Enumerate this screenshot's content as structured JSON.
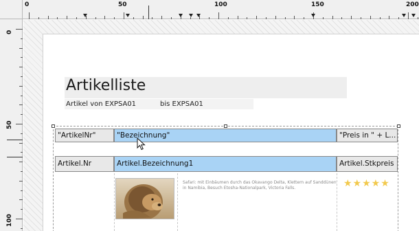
{
  "rulers": {
    "horizontal_labels": [
      "0",
      "50",
      "100",
      "150",
      "200"
    ],
    "vertical_labels": [
      "0",
      "50",
      "100"
    ]
  },
  "report": {
    "title": "Artikelliste",
    "subtitle_from": "Artikel von EXPSA01",
    "subtitle_to": "bis EXPSA01"
  },
  "table": {
    "header": [
      "\"ArtikelNr\"",
      "\"Bezeichnung\"",
      "\"Preis in \" + L..."
    ],
    "fields": [
      "Artikel.Nr",
      "Artikel.Bezeichnung1",
      "Artikel.Stkpreis"
    ],
    "description": "Safari: mit Einbäumen durch das Okavango Delta, Klettern auf Sanddünen in Namibia, Besuch Etosha-Nationalpark, Victoria Falls.",
    "rating": "★★★★★",
    "rating_color": "#f2c94c",
    "highlight_color": "#a9d3f5"
  },
  "icons": {
    "cursor": "arrow-cursor-icon",
    "photo": "lion-photo"
  }
}
